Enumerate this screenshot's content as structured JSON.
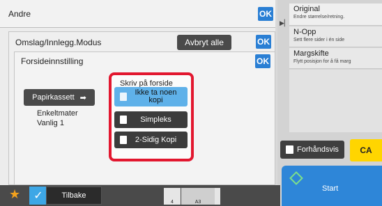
{
  "panels": {
    "andre": {
      "title": "Andre",
      "ok_label": "OK"
    },
    "omslag": {
      "title": "Omslag/Innlegg.Modus",
      "cancel_all_label": "Avbryt alle",
      "ok_label": "OK"
    },
    "forside": {
      "title": "Forsideinnstilling",
      "ok_label": "OK",
      "paper_button_label": "Papirkassett",
      "paper_info": [
        "Enkeltmater",
        "Vanlig 1"
      ],
      "print_group": {
        "title": "Skriv på forside",
        "options": [
          {
            "label": "Ikke ta noen kopi",
            "selected": true,
            "icon": "blank-page-icon"
          },
          {
            "label": "Simpleks",
            "selected": false,
            "icon": "single-sided-page-icon"
          },
          {
            "label": "2-Sidig Kopi",
            "selected": false,
            "icon": "double-sided-page-icon"
          }
        ]
      }
    }
  },
  "right_panel": {
    "items": [
      {
        "title": "Original",
        "subtitle": "Endre størrelse/retning."
      },
      {
        "title": "N-Opp",
        "subtitle": "Sett flere sider i én side"
      },
      {
        "title": "Margskifte",
        "subtitle": "Flytt posisjon for å få marg"
      }
    ],
    "preview_label": "Forhåndsvis",
    "ca_label": "CA",
    "start_label": "Start"
  },
  "bottom_bar": {
    "back_label": "Tilbake",
    "tray_labels": [
      "4",
      "A3"
    ]
  },
  "colors": {
    "ok_blue": "#2a7fd4",
    "highlight_red": "#e2172f",
    "selected_option": "#5fb1e9",
    "ca_yellow": "#ffd500",
    "start_blue": "#2e86d8"
  }
}
